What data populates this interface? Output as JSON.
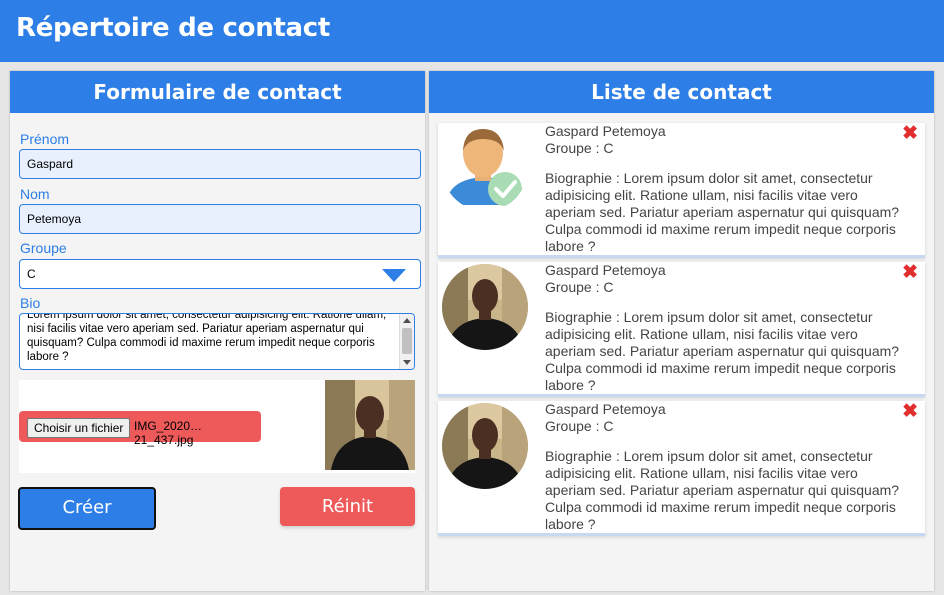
{
  "app": {
    "title": "Répertoire de contact"
  },
  "form": {
    "heading": "Formulaire de contact",
    "firstname_label": "Prénom",
    "firstname_value": "Gaspard",
    "lastname_label": "Nom",
    "lastname_value": "Petemoya",
    "group_label": "Groupe",
    "group_value": "C",
    "bio_label": "Bio",
    "bio_value": "Lorem ipsum dolor sit amet, consectetur adipisicing elit. Ratione ullam, nisi facilis vitae vero aperiam sed. Pariatur aperiam aspernatur qui quisquam? Culpa commodi id maxime rerum impedit neque corporis labore ?",
    "file_button_label": "Choisir un fichier",
    "file_name": "IMG_2020…21_437.jpg",
    "create_label": "Créer",
    "reset_label": "Réinit"
  },
  "list": {
    "heading": "Liste de contact",
    "contacts": [
      {
        "name": "Gaspard Petemoya",
        "group": "Groupe : C",
        "bio": "Biographie : Lorem ipsum dolor sit amet, consectetur adipisicing elit. Ratione ullam, nisi facilis vitae vero aperiam sed. Pariatur aperiam aspernatur qui quisquam? Culpa commodi id maxime rerum impedit neque corporis labore ?",
        "avatar": "default-user-icon"
      },
      {
        "name": "Gaspard Petemoya",
        "group": "Groupe : C",
        "bio": "Biographie : Lorem ipsum dolor sit amet, consectetur adipisicing elit. Ratione ullam, nisi facilis vitae vero aperiam sed. Pariatur aperiam aspernatur qui quisquam? Culpa commodi id maxime rerum impedit neque corporis labore ?",
        "avatar": "photo"
      },
      {
        "name": "Gaspard Petemoya",
        "group": "Groupe : C",
        "bio": "Biographie : Lorem ipsum dolor sit amet, consectetur adipisicing elit. Ratione ullam, nisi facilis vitae vero aperiam sed. Pariatur aperiam aspernatur qui quisquam? Culpa commodi id maxime rerum impedit neque corporis labore ?",
        "avatar": "photo"
      }
    ]
  },
  "colors": {
    "primary": "#2d7ee6",
    "danger": "#ee5a5a",
    "delete": "#e02d2d",
    "panel_bg": "#f4f4f4"
  },
  "icons": {
    "delete": "close-icon",
    "select": "chevron-down-icon"
  }
}
